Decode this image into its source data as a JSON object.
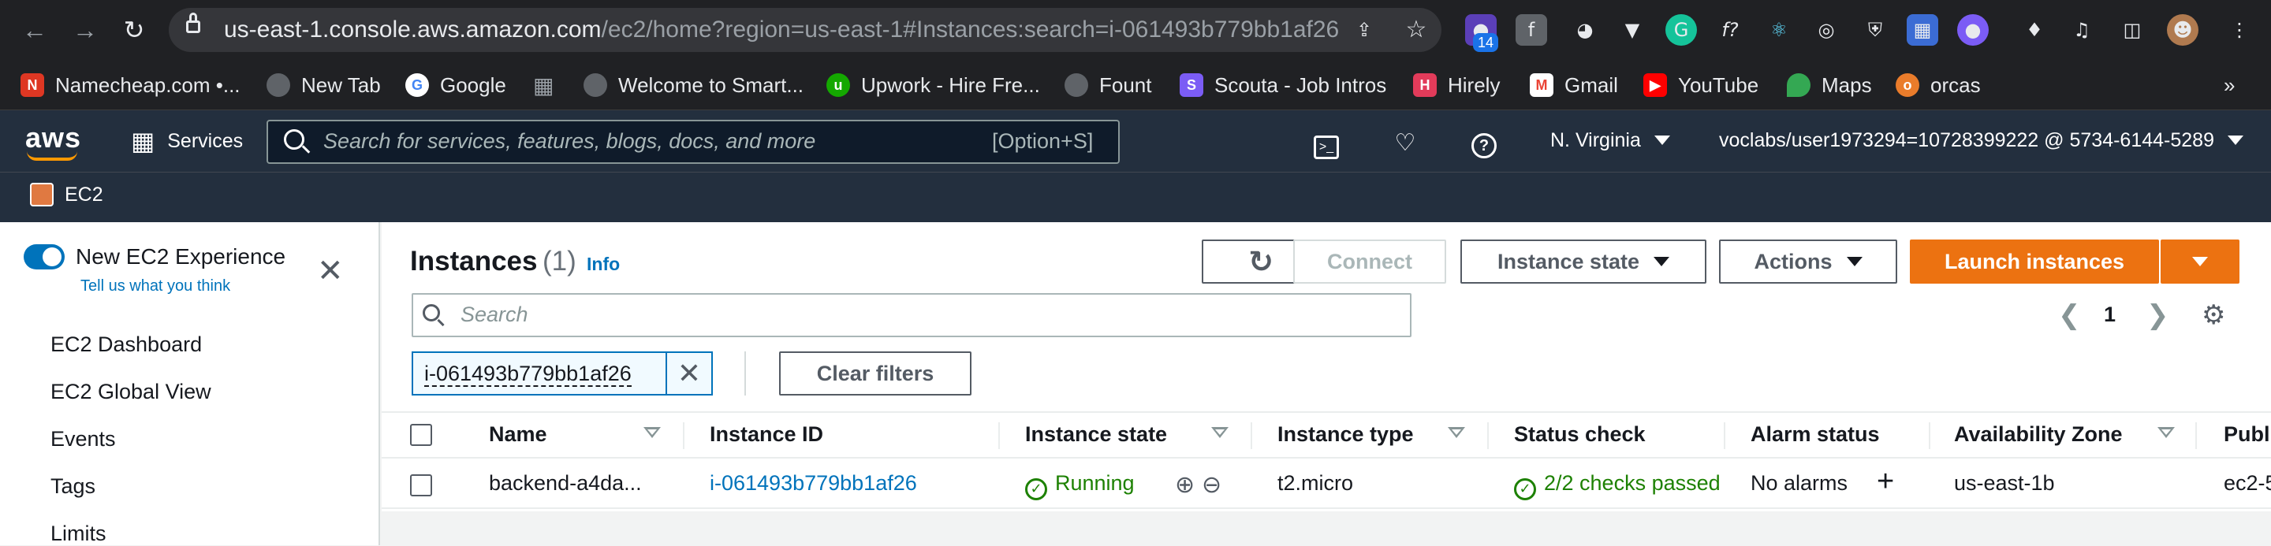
{
  "browser": {
    "url_host": "us-east-1.console.aws.amazon.com",
    "url_path": "/ec2/home?region=us-east-1#Instances:search=i-061493b779bb1af26",
    "nav_icons": [
      "back-arrow-icon",
      "forward-arrow-icon",
      "reload-icon",
      "lock-icon"
    ],
    "extension_badge": "14",
    "bookmarks": [
      {
        "label": "Namecheap.com •...",
        "icon": "namecheap-icon",
        "color": "#de3723"
      },
      {
        "label": "New Tab",
        "icon": "globe-icon",
        "color": "#5f6368"
      },
      {
        "label": "Google",
        "icon": "google-icon",
        "color": "#4285f4"
      },
      {
        "label": "Welcome to Smart...",
        "icon": "globe-icon",
        "color": "#5f6368"
      },
      {
        "label": "Upwork - Hire Fre...",
        "icon": "upwork-icon",
        "color": "#14a800"
      },
      {
        "label": "Fount",
        "icon": "globe-icon",
        "color": "#5f6368"
      },
      {
        "label": "Scouta - Job Intros",
        "icon": "scouta-icon",
        "color": "#7b5cf5"
      },
      {
        "label": "Hirely",
        "icon": "hirely-icon",
        "color": "#e23b5a"
      },
      {
        "label": "Gmail",
        "icon": "gmail-icon",
        "color": "#ea4335"
      },
      {
        "label": "YouTube",
        "icon": "youtube-icon",
        "color": "#ff0000"
      },
      {
        "label": "Maps",
        "icon": "maps-icon",
        "color": "#34a853"
      },
      {
        "label": "orcas",
        "icon": "orcas-icon",
        "color": "#ea7c2b"
      }
    ],
    "more_bookmarks": "»"
  },
  "aws_header": {
    "logo": "aws",
    "services_label": "Services",
    "search_placeholder": "Search for services, features, blogs, docs, and more",
    "search_shortcut": "[Option+S]",
    "region": "N. Virginia",
    "account": "voclabs/user1973294=10728399222 @ 5734-6144-5289",
    "breadcrumb_service": "EC2",
    "accent": "#ff9900"
  },
  "sidebar": {
    "new_experience_label": "New EC2 Experience",
    "feedback_link": "Tell us what you think",
    "toggle_on": true,
    "items": [
      {
        "label": "EC2 Dashboard"
      },
      {
        "label": "EC2 Global View"
      },
      {
        "label": "Events"
      },
      {
        "label": "Tags"
      },
      {
        "label": "Limits"
      }
    ]
  },
  "instances": {
    "title": "Instances",
    "count": "(1)",
    "info_link": "Info",
    "buttons": {
      "connect": "Connect",
      "instance_state": "Instance state",
      "actions": "Actions",
      "launch": "Launch instances"
    },
    "search_placeholder": "Search",
    "filter_token": "i-061493b779bb1af26",
    "clear_filters": "Clear filters",
    "page_number": "1",
    "columns": [
      "Name",
      "Instance ID",
      "Instance state",
      "Instance type",
      "Status check",
      "Alarm status",
      "Availability Zone",
      "Publ"
    ],
    "rows": [
      {
        "name": "backend-a4da...",
        "instance_id": "i-061493b779bb1af26",
        "state": "Running",
        "type": "t2.micro",
        "status_check": "2/2 checks passed",
        "alarm_status": "No alarms",
        "availability_zone": "us-east-1b",
        "public": "ec2-5"
      }
    ],
    "colors": {
      "link": "#0073bb",
      "success": "#1d8102",
      "primary_button": "#ec7211"
    }
  }
}
